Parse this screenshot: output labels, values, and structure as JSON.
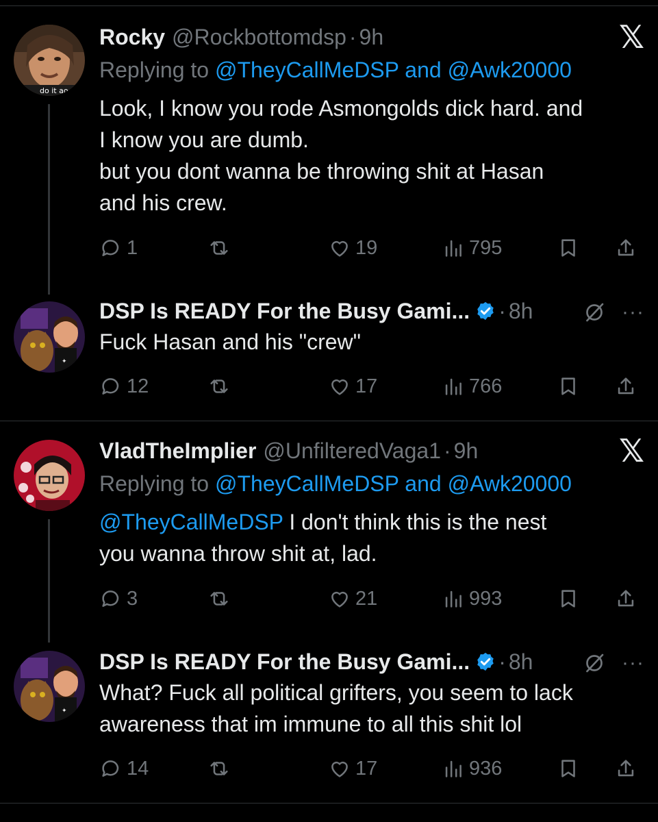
{
  "tweets": [
    {
      "name": "Rocky",
      "handle": "@Rockbottomdsp",
      "time": "9h",
      "reply_prefix": "Replying to",
      "reply_user1": "@TheyCallMeDSP",
      "reply_and": "and",
      "reply_user2": "@Awk20000",
      "avatar_caption": "do it ao",
      "lines": [
        "Look, I know you rode Asmongolds dick hard. and",
        "I know you are dumb.",
        "but you dont wanna be throwing shit at Hasan",
        "and his crew."
      ],
      "replies": "1",
      "likes": "19",
      "views": "795"
    },
    {
      "name": "DSP Is READY For the Busy Gami...",
      "time": "8h",
      "lines": [
        "Fuck Hasan and his \"crew\""
      ],
      "replies": "12",
      "likes": "17",
      "views": "766"
    },
    {
      "name": "VladTheImplier",
      "handle": "@UnfilteredVaga1",
      "time": "9h",
      "reply_prefix": "Replying to",
      "reply_user1": "@TheyCallMeDSP",
      "reply_and": "and",
      "reply_user2": "@Awk20000",
      "body_mention": "@TheyCallMeDSP",
      "lines": [
        "I don't think this is the nest",
        "you wanna throw shit at, lad."
      ],
      "replies": "3",
      "likes": "21",
      "views": "993"
    },
    {
      "name": "DSP Is READY For the Busy Gami...",
      "time": "8h",
      "lines": [
        "What? Fuck all political grifters, you seem to lack",
        "awareness that im immune to all this shit lol"
      ],
      "replies": "14",
      "likes": "17",
      "views": "936"
    }
  ],
  "icons": {
    "x_logo": "x-logo",
    "grok": "grok-icon",
    "more": "more-icon",
    "reply": "reply-icon",
    "retweet": "retweet-icon",
    "like": "heart-icon",
    "views": "views-icon",
    "bookmark": "bookmark-icon",
    "share": "share-icon"
  },
  "colors": {
    "background": "#000000",
    "text": "#e7e9ea",
    "muted": "#71767b",
    "link": "#1d9bf0",
    "verified": "#1d9bf0"
  }
}
